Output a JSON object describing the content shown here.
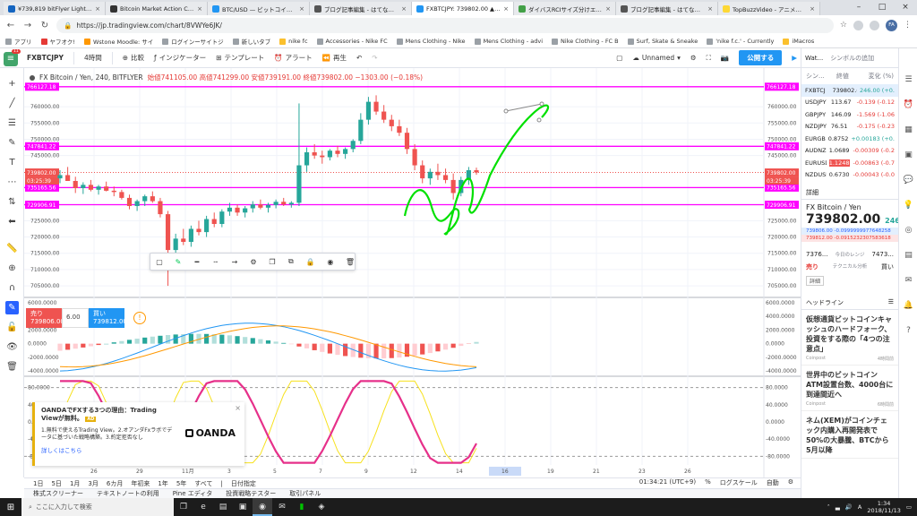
{
  "browser": {
    "tabs": [
      {
        "label": "¥739,819 bitFlyer Lightning",
        "active": false
      },
      {
        "label": "Bitcoin Market Action Chec",
        "active": false
      },
      {
        "label": "BTC/USD — ビットコインチャー",
        "active": false
      },
      {
        "label": "ブログ記事編集 - はてなブログ",
        "active": false
      },
      {
        "label": "FXBTCJPY: 739802.00 ▲+0.",
        "active": true
      },
      {
        "label": "ダイバスRCIサイズ分けエントリ",
        "active": false
      },
      {
        "label": "ブログ記事編集 - はてなブログ",
        "active": false
      },
      {
        "label": "TopBuzzVideo - アニメ・映画",
        "active": false
      }
    ],
    "url": "https://jp.tradingview.com/chart/8VWYe6JK/",
    "bookmarks": [
      "アプリ",
      "ヤフオク!",
      "Wstone Moodle: サイ",
      "ログインーサイトジ",
      "新しいタブ",
      "nike fc",
      "Accessories - Nike FC",
      "Mens Clothing - Nike",
      "Mens Clothing - advi",
      "Nike Clothing - FC B",
      "Surf, Skate & Sneake",
      "'nike f.c.' - Currently",
      "iMacros"
    ],
    "avatar": "FA"
  },
  "toolbar": {
    "symbol": "FXBTCJPY",
    "interval": "4時間",
    "compare": "比較",
    "indicators": "インジケーター",
    "templates": "テンプレート",
    "alert": "アラート",
    "replay": "再生",
    "layout": "Unnamed",
    "publish": "公開する",
    "logo_badge": "11"
  },
  "legend": {
    "title": "FX Bitcoin / Yen, 240, BITFLYER",
    "ohlc": "始値741105.00  高値741299.00  安値739191.00  終値739802.00  −1303.00 (−0.18%)"
  },
  "trade": {
    "sell_label": "売り",
    "sell_price": "739806.00",
    "qty": "6.00",
    "buy_label": "買い",
    "buy_price": "739812.00"
  },
  "price_axis": {
    "labels": [
      "760000.00",
      "755000.00",
      "750000.00",
      "745000.00",
      "735000.00",
      "730000.00",
      "725000.00",
      "720000.00",
      "715000.00",
      "710000.00",
      "705000.00"
    ],
    "macd_labels": [
      "6000.0000",
      "4000.0000",
      "2000.0000",
      "0.0000",
      "-2000.0000",
      "-4000.0000"
    ],
    "osc_labels": [
      "80.0000",
      "40.0000",
      "0.0000",
      "-40.0000",
      "-80.0000"
    ],
    "tags": {
      "line1": "766127.18",
      "line2": "747841.22",
      "current": "739802.00",
      "countdown": "03:25:39",
      "line3": "735165.56",
      "line4": "729906.91"
    }
  },
  "time_axis": {
    "labels": [
      "26",
      "29",
      "11月",
      "3",
      "5",
      "7",
      "9",
      "12",
      "14",
      "16",
      "19",
      "21",
      "23",
      "26"
    ],
    "highlight": "16"
  },
  "oanda": {
    "title": "OANDAでFXする3つの理由：Trading Viewが無料。",
    "badge": "AD",
    "body": "1.無料で使えるTrading View。2.オアンダFxラボでデータに基づいた戦略構築。3.約定拒否なし",
    "link": "詳しくはこちら",
    "logo": "OANDA"
  },
  "bottom": {
    "ranges": [
      "1日",
      "5日",
      "1月",
      "3月",
      "6カ月",
      "年初来",
      "1年",
      "5年",
      "すべて"
    ],
    "goto": "日付指定",
    "clock": "01:34:21 (UTC+9)",
    "percent": "%",
    "log": "ログスケール",
    "auto": "自動",
    "panels": [
      "株式スクリーナー",
      "テキストノートの利用",
      "Pine エディタ",
      "投資戦略テスター",
      "取引パネル"
    ]
  },
  "watchlist": {
    "title": "Wat...",
    "add": "シンボルの追加",
    "head": [
      "シン...",
      "終値",
      "変化 (%)"
    ],
    "rows": [
      {
        "sym": "FXBTCJ",
        "last": "739802.00",
        "chg": "246.00 (+0.",
        "pos": true,
        "sel": true
      },
      {
        "sym": "USDJPY",
        "last": "113.67",
        "chg": "-0.139 (-0.12",
        "pos": false,
        "sel": false
      },
      {
        "sym": "GBPJPY",
        "last": "146.09",
        "chg": "-1.569 (-1.06",
        "pos": false,
        "sel": false
      },
      {
        "sym": "NZDJPY",
        "last": "76.51",
        "chg": "-0.175 (-0.23",
        "pos": false,
        "sel": false
      },
      {
        "sym": "EURGBP",
        "last": "0.8752",
        "chg": "+0.00183 (+0.",
        "pos": true,
        "sel": false
      },
      {
        "sym": "AUDNZD",
        "last": "1.0689",
        "chg": "-0.00309 (-0.2",
        "pos": false,
        "sel": false
      },
      {
        "sym": "EURUSD",
        "last": "1.1248",
        "chg": "-0.00863 (-0.7",
        "pos": false,
        "sel": false
      },
      {
        "sym": "NZDUSD",
        "last": "0.6730",
        "chg": "-0.00043 (-0.0",
        "pos": false,
        "sel": false
      }
    ],
    "detail_title": "詳細",
    "detail_name": "FX Bitcoin / Yen",
    "detail_price": "739802.00",
    "detail_change": "246.",
    "detail_line_a": "739806.00 -0.0999999977648258",
    "detail_line_b": "739812.00 -0.0915232307583618",
    "range_low": "7376...",
    "range_label": "今日のレンジ",
    "range_high": "7473...",
    "tech_sell": "売り",
    "tech_label": "テクニカル分析",
    "tech_buy": "買い",
    "detail_btn": "詳細",
    "news_title": "ヘッドライン",
    "news": [
      {
        "title": "仮想通貨ビットコインキャッシュのハードフォーク、投資をする際の「4つの注意点」",
        "source": "Coinpost",
        "time": "4時間前"
      },
      {
        "title": "世界中のビットコインATM設置台数、4000台に到達間近へ",
        "source": "Coinpost",
        "time": "6時間前"
      },
      {
        "title": "ネム(XEM)がコインチェック内購入再開発表で50%の大暴騰、BTCから5月以降",
        "source": "",
        "time": ""
      }
    ]
  },
  "taskbar": {
    "search": "ここに入力して検索",
    "time": "1:34",
    "date": "2018/11/13"
  },
  "chart_data": {
    "type": "candlestick",
    "title": "FX Bitcoin / Yen, 240, BITFLYER",
    "x_labels": [
      "26",
      "29",
      "11月",
      "3",
      "5",
      "7",
      "9",
      "12",
      "14",
      "16",
      "19",
      "21",
      "23",
      "26"
    ],
    "ylim": [
      702000,
      768000
    ],
    "candles": [
      [
        738000,
        740500,
        736500,
        739000
      ],
      [
        739000,
        741500,
        737800,
        737200
      ],
      [
        737200,
        738500,
        733500,
        735000
      ],
      [
        735000,
        736800,
        733200,
        736000
      ],
      [
        736000,
        737500,
        734000,
        734500
      ],
      [
        734500,
        736000,
        733000,
        735500
      ],
      [
        735500,
        737000,
        734000,
        734200
      ],
      [
        734200,
        735500,
        732500,
        733800
      ],
      [
        733800,
        734500,
        731500,
        732000
      ],
      [
        732000,
        733000,
        728500,
        729500
      ],
      [
        729500,
        731500,
        728000,
        731000
      ],
      [
        731000,
        733000,
        729500,
        732500
      ],
      [
        732500,
        734000,
        730500,
        731000
      ],
      [
        731000,
        732000,
        726000,
        727000
      ],
      [
        727000,
        728000,
        705000,
        716000
      ],
      [
        716000,
        721000,
        713500,
        719500
      ],
      [
        719500,
        722500,
        717500,
        718500
      ],
      [
        718500,
        723500,
        717000,
        722500
      ],
      [
        722500,
        725000,
        720500,
        721500
      ],
      [
        721500,
        726500,
        720000,
        725500
      ],
      [
        725500,
        727500,
        723000,
        724000
      ],
      [
        724000,
        728500,
        723000,
        727800
      ],
      [
        727800,
        730500,
        726500,
        729000
      ],
      [
        729000,
        730000,
        726500,
        727500
      ],
      [
        727500,
        729500,
        726000,
        728800
      ],
      [
        728800,
        731000,
        727500,
        730000
      ],
      [
        730000,
        731500,
        728500,
        729000
      ],
      [
        729000,
        730500,
        727500,
        729800
      ],
      [
        729800,
        731500,
        728800,
        730800
      ],
      [
        730800,
        732000,
        729500,
        730000
      ],
      [
        730000,
        731000,
        729000,
        730500
      ],
      [
        730500,
        761000,
        729500,
        742000
      ],
      [
        742000,
        747500,
        740000,
        746000
      ],
      [
        746000,
        748500,
        744000,
        745000
      ],
      [
        745000,
        746500,
        742500,
        744500
      ],
      [
        744500,
        747000,
        743500,
        746500
      ],
      [
        746500,
        748000,
        744500,
        745500
      ],
      [
        745500,
        747500,
        744000,
        747000
      ],
      [
        747000,
        750000,
        746000,
        749500
      ],
      [
        749500,
        758000,
        748500,
        756000
      ],
      [
        756000,
        763000,
        754500,
        761500
      ],
      [
        761500,
        763500,
        757500,
        758500
      ],
      [
        758500,
        760500,
        755000,
        756000
      ],
      [
        756000,
        757500,
        752500,
        754000
      ],
      [
        754000,
        756000,
        751000,
        752000
      ],
      [
        752000,
        753500,
        745500,
        747000
      ],
      [
        747000,
        748500,
        740500,
        742000
      ],
      [
        742000,
        743500,
        736500,
        738000
      ],
      [
        738000,
        741000,
        736000,
        740000
      ],
      [
        740000,
        742500,
        737500,
        739000
      ],
      [
        739000,
        741000,
        736500,
        737500
      ],
      [
        737500,
        739500,
        731500,
        733500
      ],
      [
        733500,
        738500,
        732500,
        737500
      ],
      [
        737500,
        741500,
        736000,
        740500
      ],
      [
        740500,
        741300,
        739100,
        739800
      ]
    ],
    "hlines": [
      766127.18,
      747841.22,
      735165.56,
      729906.91
    ],
    "current": 739802
  }
}
